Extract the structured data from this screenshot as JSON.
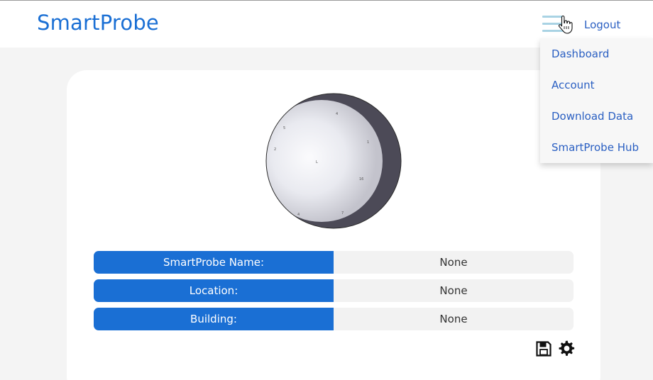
{
  "header": {
    "brand": "SmartProbe",
    "menu_icon": "hamburger-menu-icon",
    "logout_label": "Logout"
  },
  "dropdown": {
    "items": [
      {
        "label": "Dashboard"
      },
      {
        "label": "Account"
      },
      {
        "label": "Download Data"
      },
      {
        "label": "SmartProbe Hub"
      }
    ]
  },
  "probe": {
    "rows": [
      {
        "label": "SmartProbe Name:",
        "value": "None"
      },
      {
        "label": "Location:",
        "value": "None"
      },
      {
        "label": "Building:",
        "value": "None"
      }
    ]
  },
  "actions": {
    "save_icon": "floppy-disk-save-icon",
    "settings_icon": "gear-icon"
  },
  "colors": {
    "brand": "#1a6fd4",
    "link": "#2a5fc2",
    "page_bg": "#f4f4f4",
    "value_bg": "#f2f2f2"
  }
}
